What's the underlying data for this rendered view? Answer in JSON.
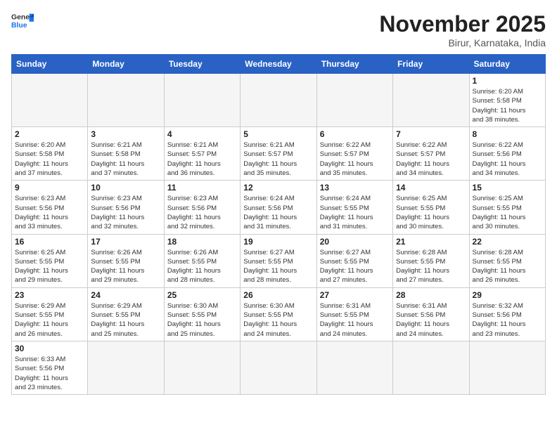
{
  "header": {
    "logo_general": "General",
    "logo_blue": "Blue",
    "month_title": "November 2025",
    "location": "Birur, Karnataka, India"
  },
  "weekdays": [
    "Sunday",
    "Monday",
    "Tuesday",
    "Wednesday",
    "Thursday",
    "Friday",
    "Saturday"
  ],
  "weeks": [
    [
      {
        "day": "",
        "text": ""
      },
      {
        "day": "",
        "text": ""
      },
      {
        "day": "",
        "text": ""
      },
      {
        "day": "",
        "text": ""
      },
      {
        "day": "",
        "text": ""
      },
      {
        "day": "",
        "text": ""
      },
      {
        "day": "1",
        "text": "Sunrise: 6:20 AM\nSunset: 5:58 PM\nDaylight: 11 hours\nand 38 minutes."
      }
    ],
    [
      {
        "day": "2",
        "text": "Sunrise: 6:20 AM\nSunset: 5:58 PM\nDaylight: 11 hours\nand 37 minutes."
      },
      {
        "day": "3",
        "text": "Sunrise: 6:21 AM\nSunset: 5:58 PM\nDaylight: 11 hours\nand 37 minutes."
      },
      {
        "day": "4",
        "text": "Sunrise: 6:21 AM\nSunset: 5:57 PM\nDaylight: 11 hours\nand 36 minutes."
      },
      {
        "day": "5",
        "text": "Sunrise: 6:21 AM\nSunset: 5:57 PM\nDaylight: 11 hours\nand 35 minutes."
      },
      {
        "day": "6",
        "text": "Sunrise: 6:22 AM\nSunset: 5:57 PM\nDaylight: 11 hours\nand 35 minutes."
      },
      {
        "day": "7",
        "text": "Sunrise: 6:22 AM\nSunset: 5:57 PM\nDaylight: 11 hours\nand 34 minutes."
      },
      {
        "day": "8",
        "text": "Sunrise: 6:22 AM\nSunset: 5:56 PM\nDaylight: 11 hours\nand 34 minutes."
      }
    ],
    [
      {
        "day": "9",
        "text": "Sunrise: 6:23 AM\nSunset: 5:56 PM\nDaylight: 11 hours\nand 33 minutes."
      },
      {
        "day": "10",
        "text": "Sunrise: 6:23 AM\nSunset: 5:56 PM\nDaylight: 11 hours\nand 32 minutes."
      },
      {
        "day": "11",
        "text": "Sunrise: 6:23 AM\nSunset: 5:56 PM\nDaylight: 11 hours\nand 32 minutes."
      },
      {
        "day": "12",
        "text": "Sunrise: 6:24 AM\nSunset: 5:56 PM\nDaylight: 11 hours\nand 31 minutes."
      },
      {
        "day": "13",
        "text": "Sunrise: 6:24 AM\nSunset: 5:55 PM\nDaylight: 11 hours\nand 31 minutes."
      },
      {
        "day": "14",
        "text": "Sunrise: 6:25 AM\nSunset: 5:55 PM\nDaylight: 11 hours\nand 30 minutes."
      },
      {
        "day": "15",
        "text": "Sunrise: 6:25 AM\nSunset: 5:55 PM\nDaylight: 11 hours\nand 30 minutes."
      }
    ],
    [
      {
        "day": "16",
        "text": "Sunrise: 6:25 AM\nSunset: 5:55 PM\nDaylight: 11 hours\nand 29 minutes."
      },
      {
        "day": "17",
        "text": "Sunrise: 6:26 AM\nSunset: 5:55 PM\nDaylight: 11 hours\nand 29 minutes."
      },
      {
        "day": "18",
        "text": "Sunrise: 6:26 AM\nSunset: 5:55 PM\nDaylight: 11 hours\nand 28 minutes."
      },
      {
        "day": "19",
        "text": "Sunrise: 6:27 AM\nSunset: 5:55 PM\nDaylight: 11 hours\nand 28 minutes."
      },
      {
        "day": "20",
        "text": "Sunrise: 6:27 AM\nSunset: 5:55 PM\nDaylight: 11 hours\nand 27 minutes."
      },
      {
        "day": "21",
        "text": "Sunrise: 6:28 AM\nSunset: 5:55 PM\nDaylight: 11 hours\nand 27 minutes."
      },
      {
        "day": "22",
        "text": "Sunrise: 6:28 AM\nSunset: 5:55 PM\nDaylight: 11 hours\nand 26 minutes."
      }
    ],
    [
      {
        "day": "23",
        "text": "Sunrise: 6:29 AM\nSunset: 5:55 PM\nDaylight: 11 hours\nand 26 minutes."
      },
      {
        "day": "24",
        "text": "Sunrise: 6:29 AM\nSunset: 5:55 PM\nDaylight: 11 hours\nand 25 minutes."
      },
      {
        "day": "25",
        "text": "Sunrise: 6:30 AM\nSunset: 5:55 PM\nDaylight: 11 hours\nand 25 minutes."
      },
      {
        "day": "26",
        "text": "Sunrise: 6:30 AM\nSunset: 5:55 PM\nDaylight: 11 hours\nand 24 minutes."
      },
      {
        "day": "27",
        "text": "Sunrise: 6:31 AM\nSunset: 5:55 PM\nDaylight: 11 hours\nand 24 minutes."
      },
      {
        "day": "28",
        "text": "Sunrise: 6:31 AM\nSunset: 5:56 PM\nDaylight: 11 hours\nand 24 minutes."
      },
      {
        "day": "29",
        "text": "Sunrise: 6:32 AM\nSunset: 5:56 PM\nDaylight: 11 hours\nand 23 minutes."
      }
    ],
    [
      {
        "day": "30",
        "text": "Sunrise: 6:33 AM\nSunset: 5:56 PM\nDaylight: 11 hours\nand 23 minutes."
      },
      {
        "day": "",
        "text": ""
      },
      {
        "day": "",
        "text": ""
      },
      {
        "day": "",
        "text": ""
      },
      {
        "day": "",
        "text": ""
      },
      {
        "day": "",
        "text": ""
      },
      {
        "day": "",
        "text": ""
      }
    ]
  ]
}
